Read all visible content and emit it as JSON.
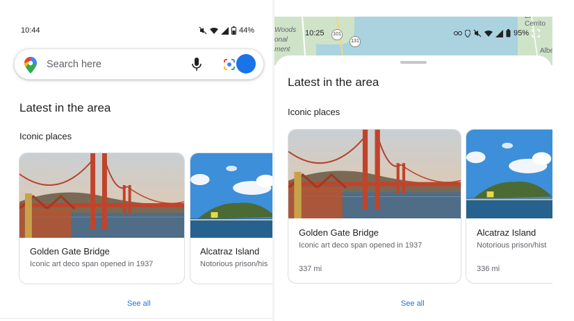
{
  "left": {
    "status": {
      "time": "10:44",
      "battery": "44%"
    },
    "search": {
      "placeholder": "Search here"
    },
    "heading": "Latest in the area",
    "section": "Iconic places",
    "cards": [
      {
        "title": "Golden Gate Bridge",
        "subtitle": "Iconic art deco span opened in 1937"
      },
      {
        "title": "Alcatraz Island",
        "subtitle": "Notorious prison/his"
      }
    ],
    "see_all": "See all"
  },
  "right": {
    "status": {
      "time": "10:25",
      "battery": "95%"
    },
    "map_labels": [
      "Woods",
      "onal",
      "ment",
      "Albe",
      "El Cerrito"
    ],
    "route_shields": [
      "101",
      "131"
    ],
    "heading": "Latest in the area",
    "section": "Iconic places",
    "cards": [
      {
        "title": "Golden Gate Bridge",
        "subtitle": "Iconic art deco span opened in 1937",
        "distance": "337 mi"
      },
      {
        "title": "Alcatraz Island",
        "subtitle": "Notorious prison/hist",
        "distance": "336 mi"
      }
    ],
    "see_all": "See all"
  },
  "colors": {
    "accent": "#1a73e8",
    "water": "#aad3df",
    "land": "#cfe3c9"
  }
}
